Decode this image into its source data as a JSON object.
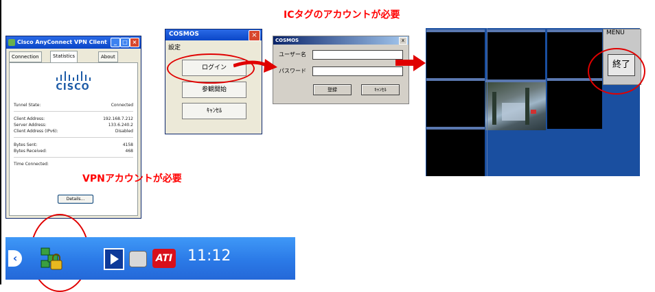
{
  "vpn_client": {
    "title": "Cisco AnyConnect VPN Client",
    "tabs": [
      "Connection",
      "Statistics",
      "About"
    ],
    "active_tab": "Statistics",
    "brand": "CISCO",
    "rows": [
      {
        "label": "Tunnel State:",
        "value": "Connected"
      },
      {
        "label": "Client Address:",
        "value": "192.168.7.212"
      },
      {
        "label": "Server Address:",
        "value": "133.6.240.2"
      },
      {
        "label": "Client Address (IPv6):",
        "value": "Disabled"
      },
      {
        "label": "Bytes Sent:",
        "value": "4158"
      },
      {
        "label": "Bytes Received:",
        "value": "468"
      },
      {
        "label": "Time Connected:",
        "value": ""
      }
    ],
    "details_button": "Details..."
  },
  "cosmos_login": {
    "title": "COSMOS",
    "menu": "設定",
    "buttons": [
      "ログイン",
      "参観開始",
      "ｷｬﾝｾﾙ"
    ]
  },
  "cosmos_dialog": {
    "title": "COSMOS",
    "close": "x",
    "user_label": "ユーザー名",
    "password_label": "パスワード",
    "user_value": "",
    "password_value": "",
    "ok_button": "登録",
    "cancel_button": "ｷｬﾝｾﾙ"
  },
  "monitor": {
    "menu_label": "MENU",
    "end_button": "終了"
  },
  "annotations": {
    "ic_tag": "ICタグのアカウントが必要",
    "vpn": "VPNアカウントが必要"
  },
  "taskbar": {
    "clock": "11:12",
    "ati_logo": "ATI"
  },
  "colors": {
    "annotation_red": "#ff0000",
    "xp_blue": "#2b7ae7",
    "monitor_blue": "#1a4fa0"
  }
}
